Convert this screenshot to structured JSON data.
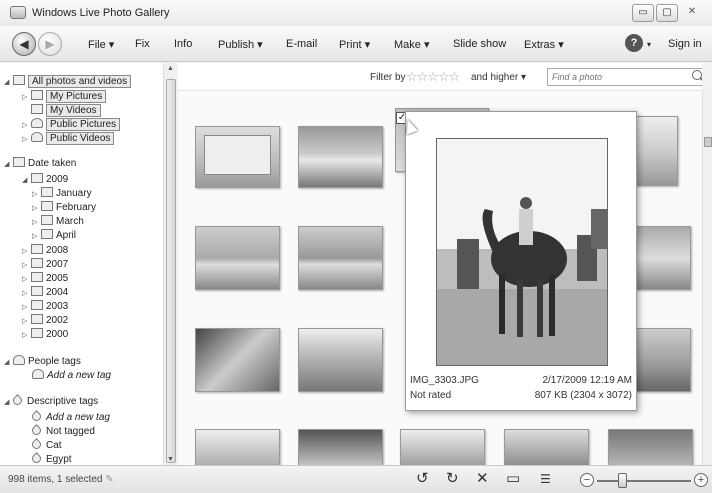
{
  "window": {
    "title": "Windows Live Photo Gallery",
    "min": "▭",
    "max": "▢",
    "close": "✕"
  },
  "menubar": {
    "items": [
      {
        "label": "File ▾"
      },
      {
        "label": "Fix"
      },
      {
        "label": "Info"
      },
      {
        "label": "Publish ▾"
      },
      {
        "label": "E-mail"
      },
      {
        "label": "Print ▾"
      },
      {
        "label": "Make ▾"
      },
      {
        "label": "Slide show"
      },
      {
        "label": "Extras ▾"
      }
    ],
    "help_label": "?",
    "help_arrow": "▾",
    "signin": "Sign in"
  },
  "sidebar": {
    "all": "All photos and videos",
    "my_pictures": "My Pictures",
    "my_videos": "My Videos",
    "public_pictures": "Public Pictures",
    "public_videos": "Public Videos",
    "date_taken": "Date taken",
    "years": {
      "y2009": "2009",
      "y2008": "2008",
      "y2007": "2007",
      "y2005": "2005",
      "y2004": "2004",
      "y2003": "2003",
      "y2002": "2002",
      "y2000": "2000"
    },
    "months": {
      "jan": "January",
      "feb": "February",
      "mar": "March",
      "apr": "April"
    },
    "people_tags": "People tags",
    "add_people_tag": "Add a new tag",
    "descriptive_tags": "Descriptive tags",
    "add_desc_tag": "Add a new tag",
    "not_tagged": "Not tagged",
    "cat": "Cat",
    "egypt": "Egypt"
  },
  "filter": {
    "label": "Filter by",
    "higher": "and higher ▾",
    "search_placeholder": "Find a photo"
  },
  "popup": {
    "filename": "IMG_3303.JPG",
    "date": "2/17/2009  12:19  AM",
    "rating": "Not rated",
    "size": "807 KB (2304 x 3072)"
  },
  "status": {
    "items": "998 items, 1 selected"
  }
}
